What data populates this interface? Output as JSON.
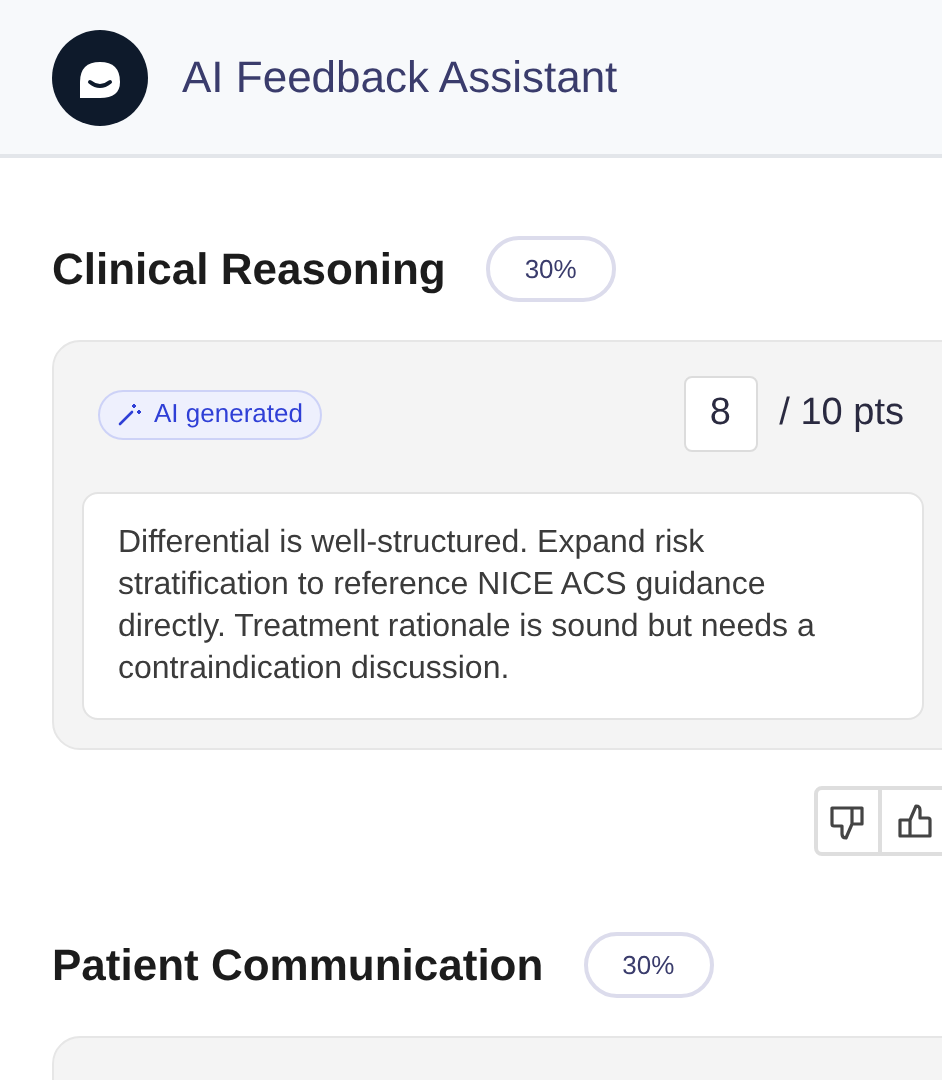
{
  "header": {
    "title": "AI Feedback Assistant"
  },
  "sections": [
    {
      "title": "Clinical Reasoning",
      "weight": "30%",
      "badge": "AI generated",
      "score": "8",
      "max": "/ 10 pts",
      "feedback": "Differential is well-structured. Expand risk stratification to reference NICE ACS guidance directly. Treatment rationale is sound but needs a contraindication discussion.",
      "rating_buttons": true
    },
    {
      "title": "Patient Communication",
      "weight": "30%"
    }
  ]
}
